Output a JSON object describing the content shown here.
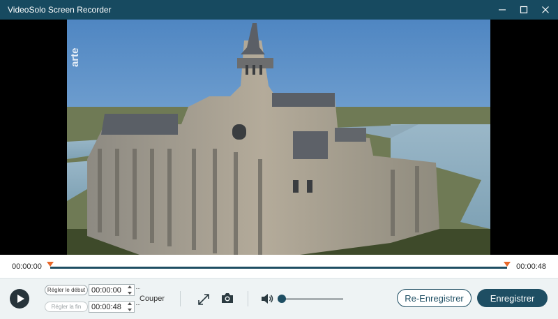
{
  "app": {
    "title": "VideoSolo Screen Recorder"
  },
  "video": {
    "watermark": "arte"
  },
  "timeline": {
    "current_time": "00:00:00",
    "end_time": "00:00:48"
  },
  "controls": {
    "set_start_label": "Régler le début",
    "start_time": "00:00:00",
    "set_end_label": "Régler la fin",
    "end_time": "00:00:48",
    "cut_label": "Couper",
    "volume": 0.0,
    "re_record_label": "Re-Enregistrer",
    "save_label": "Enregistrer"
  },
  "colors": {
    "titlebar": "#174a60",
    "accent": "#1e4e63",
    "marker": "#e8682a"
  }
}
